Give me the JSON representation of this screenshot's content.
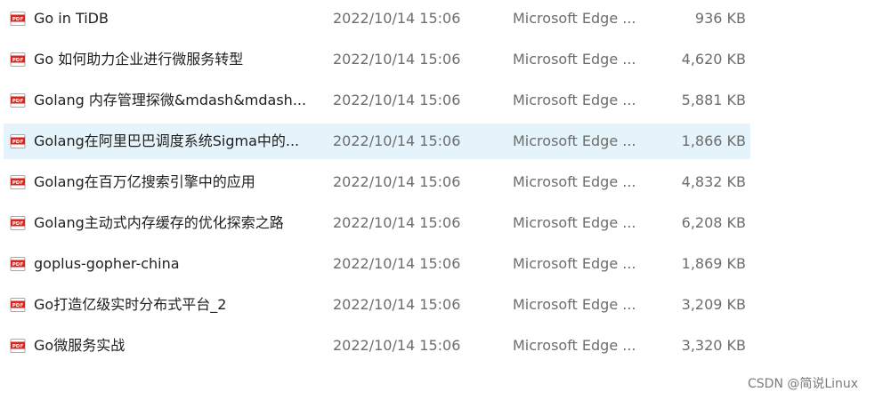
{
  "files": [
    {
      "name": "Go in TiDB",
      "date": "2022/10/14 15:06",
      "type": "Microsoft Edge ...",
      "size": "936 KB",
      "icon": "pdf-icon"
    },
    {
      "name": "Go 如何助力企业进行微服务转型",
      "date": "2022/10/14 15:06",
      "type": "Microsoft Edge ...",
      "size": "4,620 KB",
      "icon": "pdf-icon"
    },
    {
      "name": "Golang 内存管理探微&mdash&mdash...",
      "date": "2022/10/14 15:06",
      "type": "Microsoft Edge ...",
      "size": "5,881 KB",
      "icon": "pdf-icon"
    },
    {
      "name": "Golang在阿里巴巴调度系统Sigma中的...",
      "date": "2022/10/14 15:06",
      "type": "Microsoft Edge ...",
      "size": "1,866 KB",
      "icon": "pdf-icon",
      "selected": true
    },
    {
      "name": "Golang在百万亿搜索引擎中的应用",
      "date": "2022/10/14 15:06",
      "type": "Microsoft Edge ...",
      "size": "4,832 KB",
      "icon": "pdf-icon"
    },
    {
      "name": "Golang主动式内存缓存的优化探索之路",
      "date": "2022/10/14 15:06",
      "type": "Microsoft Edge ...",
      "size": "6,208 KB",
      "icon": "pdf-icon"
    },
    {
      "name": "goplus-gopher-china",
      "date": "2022/10/14 15:06",
      "type": "Microsoft Edge ...",
      "size": "1,869 KB",
      "icon": "pdf-icon"
    },
    {
      "name": "Go打造亿级实时分布式平台_2",
      "date": "2022/10/14 15:06",
      "type": "Microsoft Edge ...",
      "size": "3,209 KB",
      "icon": "pdf-icon"
    },
    {
      "name": "Go微服务实战",
      "date": "2022/10/14 15:06",
      "type": "Microsoft Edge ...",
      "size": "3,320 KB",
      "icon": "pdf-icon"
    }
  ],
  "watermark": "CSDN @简说Linux",
  "colors": {
    "selected_row": "#e5f3fb",
    "pdf_icon_red": "#d9261c",
    "secondary_text": "#6d6d6d"
  }
}
